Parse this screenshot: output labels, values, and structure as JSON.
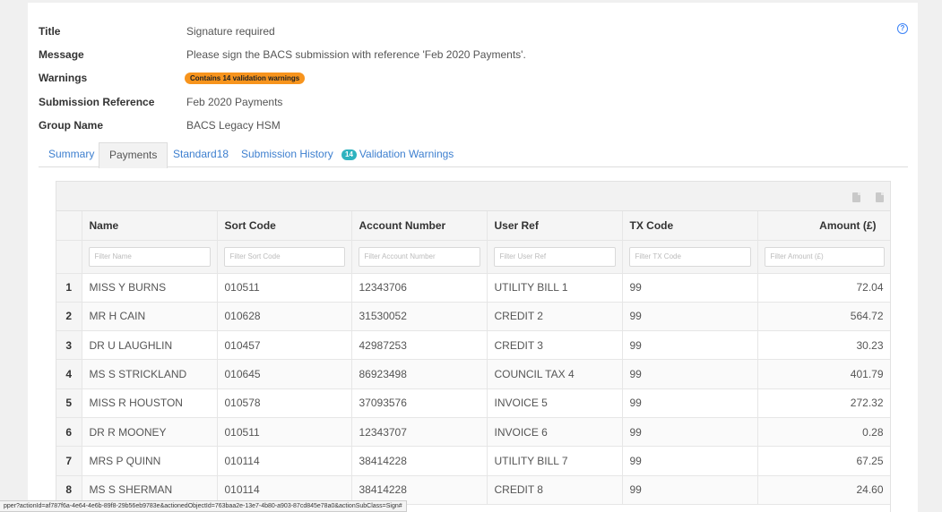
{
  "header": {
    "fields": [
      {
        "label": "Title",
        "value": "Signature required"
      },
      {
        "label": "Message",
        "value": "Please sign the BACS submission with reference 'Feb 2020 Payments'."
      },
      {
        "label": "Warnings",
        "value": ""
      },
      {
        "label": "Submission Reference",
        "value": "Feb 2020 Payments"
      },
      {
        "label": "Group Name",
        "value": "BACS Legacy HSM"
      }
    ],
    "warning_badge": "Contains 14 validation warnings",
    "help_icon": "?"
  },
  "tabs": [
    {
      "label": "Summary"
    },
    {
      "label": "Payments",
      "active": true
    },
    {
      "label": "Standard18"
    },
    {
      "label": "Submission History"
    },
    {
      "label": "Validation Warnings",
      "count": "14"
    }
  ],
  "grid": {
    "icons": [
      "pdf-export-icon",
      "excel-export-icon"
    ],
    "columns": [
      "Name",
      "Sort Code",
      "Account Number",
      "User Ref",
      "TX Code",
      "Amount (£)"
    ],
    "filters": [
      "Filter Name",
      "Filter Sort Code",
      "Filter Account Number",
      "Filter User Ref",
      "Filter TX Code",
      "Filter Amount (£)"
    ],
    "rows": [
      {
        "n": "1",
        "name": "MISS Y BURNS",
        "sort": "010511",
        "account": "12343706",
        "ref": "UTILITY BILL 1",
        "tx": "99",
        "amount": "72.04"
      },
      {
        "n": "2",
        "name": "MR H CAIN",
        "sort": "010628",
        "account": "31530052",
        "ref": "CREDIT 2",
        "tx": "99",
        "amount": "564.72"
      },
      {
        "n": "3",
        "name": "DR U LAUGHLIN",
        "sort": "010457",
        "account": "42987253",
        "ref": "CREDIT 3",
        "tx": "99",
        "amount": "30.23"
      },
      {
        "n": "4",
        "name": "MS S STRICKLAND",
        "sort": "010645",
        "account": "86923498",
        "ref": "COUNCIL TAX 4",
        "tx": "99",
        "amount": "401.79"
      },
      {
        "n": "5",
        "name": "MISS R HOUSTON",
        "sort": "010578",
        "account": "37093576",
        "ref": "INVOICE 5",
        "tx": "99",
        "amount": "272.32"
      },
      {
        "n": "6",
        "name": "DR R MOONEY",
        "sort": "010511",
        "account": "12343707",
        "ref": "INVOICE 6",
        "tx": "99",
        "amount": "0.28"
      },
      {
        "n": "7",
        "name": "MRS P QUINN",
        "sort": "010114",
        "account": "38414228",
        "ref": "UTILITY BILL 7",
        "tx": "99",
        "amount": "67.25"
      },
      {
        "n": "8",
        "name": "MS S SHERMAN",
        "sort": "010114",
        "account": "38414228",
        "ref": "CREDIT 8",
        "tx": "99",
        "amount": "24.60"
      }
    ]
  },
  "statusbar": {
    "url": "pper?actionId=af787f6a-4e64-4e6b-89f8-29b56eb9783e&actionedObjectId=763baa2e-13e7-4b80-a903-87cd845e78a0&actionSubClass=Sign#"
  }
}
